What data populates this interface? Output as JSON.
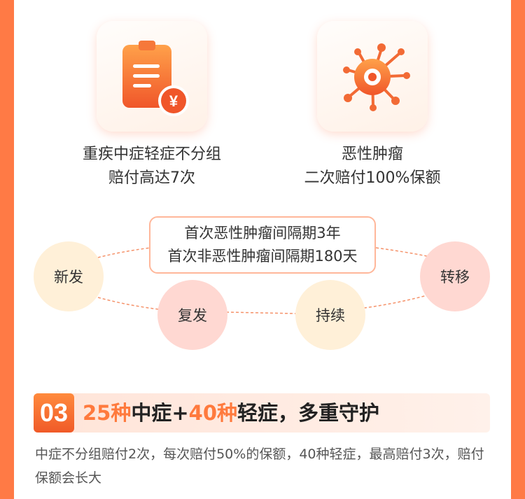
{
  "features": [
    {
      "icon": "clipboard-yen-icon",
      "line1": "重疾中症轻症不分组",
      "line2": "赔付高达7次"
    },
    {
      "icon": "virus-icon",
      "line1": "恶性肿瘤",
      "line2": "二次赔付100%保额"
    }
  ],
  "interval_note": {
    "line1": "首次恶性肿瘤间隔期3年",
    "line2": "首次非恶性肿瘤间隔期180天"
  },
  "stages": [
    "新发",
    "复发",
    "持续",
    "转移"
  ],
  "section": {
    "number": "03",
    "title_part1": "25种",
    "title_part2": "中症+",
    "title_part3": "40种",
    "title_part4": "轻症，多重守护",
    "description": "中症不分组赔付2次，每次赔付50%的保额，40种轻症，最高赔付3次，赔付保额会长大"
  },
  "colors": {
    "accent": "#ff7a45",
    "highlight": "#ff7a3d",
    "bubble_cream": "#fff0d8",
    "bubble_pink": "#ffd8d2"
  }
}
